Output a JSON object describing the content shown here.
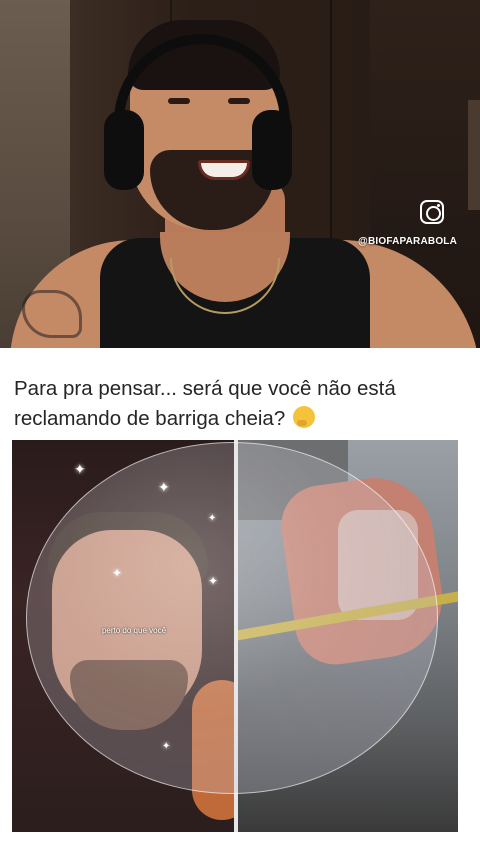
{
  "overlay": {
    "instagram_handle": "@BIOFAPARABOLA",
    "icon": "instagram-icon"
  },
  "tweet": {
    "text": "Para pra pensar... será que você não está reclamando de barriga cheia?",
    "emoji": "thinking-face-icon"
  },
  "media": {
    "caption": "perto do que você"
  }
}
